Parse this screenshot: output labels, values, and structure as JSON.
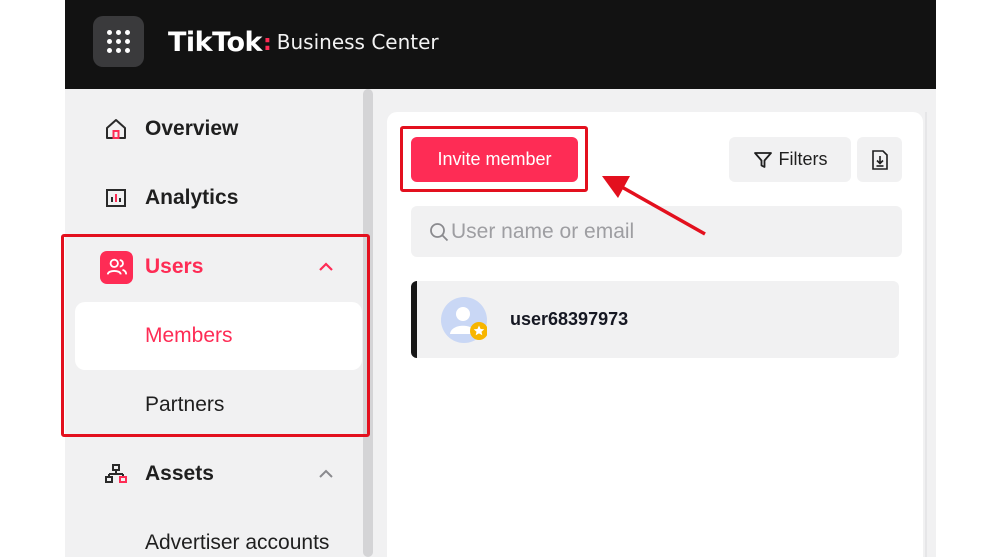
{
  "header": {
    "brand_logo": "TikTok",
    "brand_separator": ":",
    "brand_product": "Business Center",
    "apps_icon": "grid-dots-icon"
  },
  "sidebar": {
    "items": [
      {
        "label": "Overview",
        "icon": "home-icon"
      },
      {
        "label": "Analytics",
        "icon": "chart-icon"
      },
      {
        "label": "Users",
        "icon": "users-icon",
        "expanded": true,
        "children": [
          {
            "label": "Members",
            "selected": true
          },
          {
            "label": "Partners"
          }
        ]
      },
      {
        "label": "Assets",
        "icon": "hierarchy-icon",
        "expanded": true,
        "children": [
          {
            "label": "Advertiser accounts"
          }
        ]
      }
    ]
  },
  "main": {
    "invite_label": "Invite member",
    "filters_label": "Filters",
    "export_icon": "download-icon",
    "search_placeholder": "User name or email",
    "members": [
      {
        "name": "user68397973",
        "avatar": "default-avatar-icon",
        "badge": "owner-star-icon"
      }
    ]
  },
  "colors": {
    "accent": "#fe2c55",
    "topbar": "#121212",
    "sidebar_bg": "#f1f1f2",
    "annotation": "#e3101e"
  }
}
